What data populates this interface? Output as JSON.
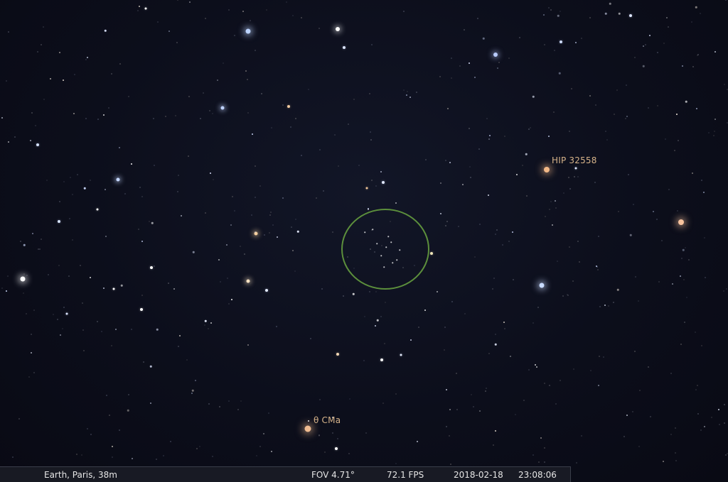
{
  "colors": {
    "sky_background": "#0b0d1a",
    "target_circle": "#5c8f3c",
    "label_orange": "#d7b48a",
    "status_text": "#e6e6e6"
  },
  "sky": {
    "labels": {
      "hip_32558": "HIP 32558",
      "theta_cma": "θ CMa"
    }
  },
  "status_bar": {
    "location": "Earth, Paris, 38m",
    "fov": "FOV 4.71°",
    "fps": "72.1 FPS",
    "date": "2018-02-18",
    "time": "23:08:06"
  }
}
